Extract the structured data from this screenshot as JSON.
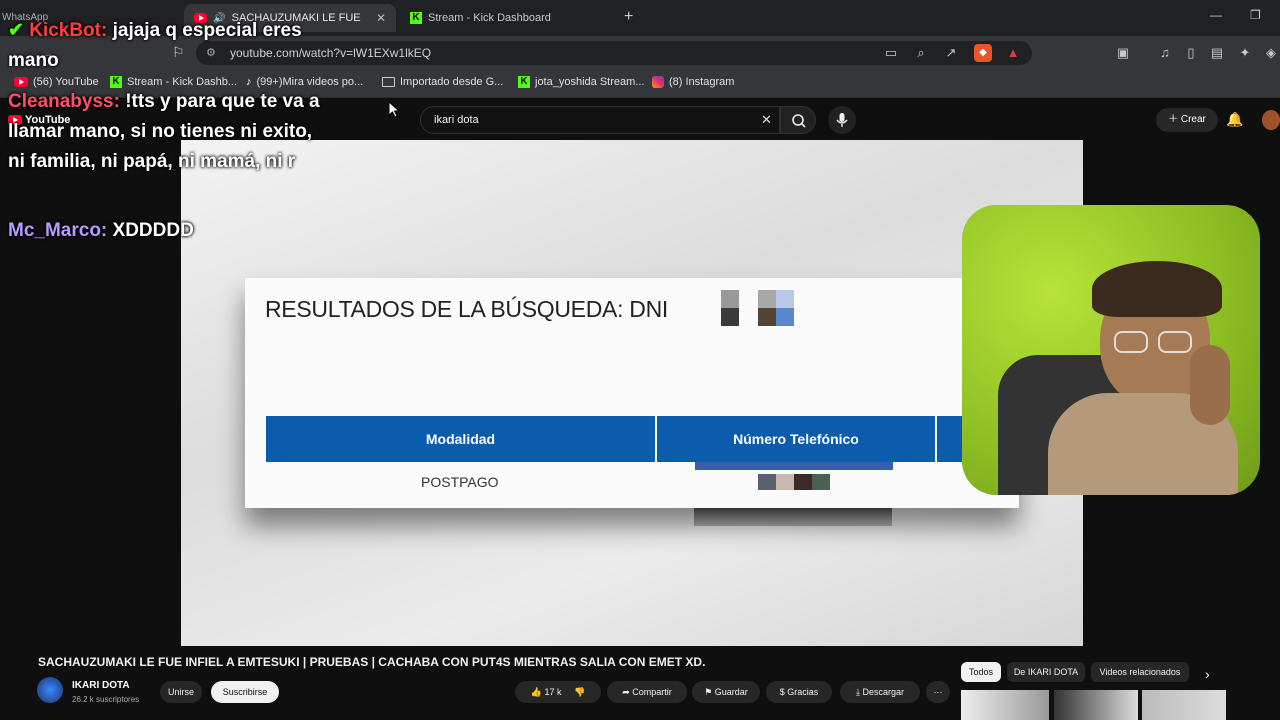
{
  "browser": {
    "os_label": "WhatsApp",
    "tabs": [
      {
        "label": "SACHAUZUMAKI LE FUE INFIE",
        "active": true
      },
      {
        "label": "Stream - Kick Dashboard",
        "active": false
      }
    ],
    "new_tab_symbol": "+",
    "url": "youtube.com/watch?v=lW1EXw1lkEQ",
    "bookmarks": [
      {
        "label": "(56) YouTube",
        "icon": "youtube-icon"
      },
      {
        "label": "Stream - Kick Dashb...",
        "icon": "kick-icon"
      },
      {
        "label": "(99+)Mira videos po...",
        "icon": "tiktok-icon"
      },
      {
        "label": "Importado desde G...",
        "icon": "folder-icon"
      },
      {
        "label": "jota_yoshida Stream...",
        "icon": "kick-icon"
      },
      {
        "label": "(8) Instagram",
        "icon": "instagram-icon"
      }
    ]
  },
  "youtube": {
    "logo": "YouTube",
    "search_value": "ikari dota",
    "create_label": "Crear"
  },
  "video": {
    "results_title": "RESULTADOS DE LA BÚSQUEDA: DNI",
    "col_modalidad": "Modalidad",
    "col_numero": "Número Telefónico",
    "row_modalidad": "POSTPAGO"
  },
  "chat": [
    {
      "user": "KickBot:",
      "message": "jajaja q especial eres mano"
    },
    {
      "user": "Cleanabyss:",
      "message": "!tts y para que te va a llamar mano, si no tienes ni exito, ni familia, ni papá, ni mamá, ni r"
    },
    {
      "user": "Mc_Marco:",
      "message": "XDDDDD"
    }
  ],
  "below": {
    "title": "SACHAUZUMAKI LE FUE INFIEL A EMTESUKI | PRUEBAS | CACHABA CON PUT4S MIENTRAS SALIA CON EMET XD.",
    "channel": "IKARI DOTA",
    "subscribers": "26.2 k suscriptores",
    "join": "Unirse",
    "subscribe": "Suscribirse",
    "likes": "17 k",
    "share": "Compartir",
    "save": "Guardar",
    "thanks": "Gracias",
    "download": "Descargar",
    "more": "···",
    "chips": [
      "Todos",
      "De IKARI DOTA",
      "Videos relacionados"
    ]
  },
  "colors": {
    "accent_red": "#ff0033",
    "kick_green": "#53fc18",
    "table_blue": "#0b5cad"
  }
}
